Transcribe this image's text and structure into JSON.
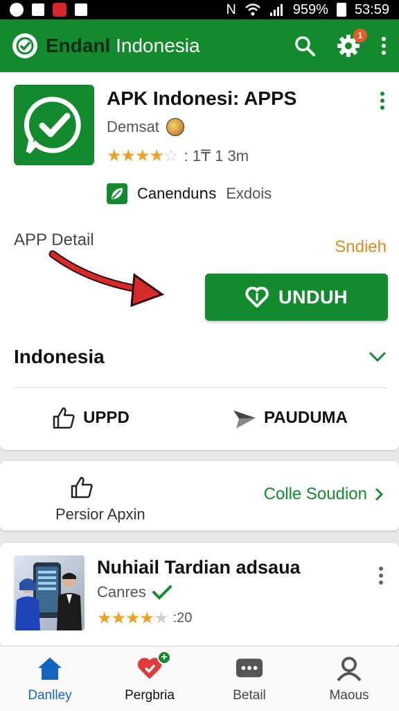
{
  "status_bar": {
    "battery": "959%",
    "time": "53:59",
    "signal_text": "N"
  },
  "app_bar": {
    "title_bold": "Endanl",
    "title_rest": "Indonesia",
    "notification_badge": "1"
  },
  "app": {
    "name": "APK Indonesi: APPS",
    "developer": "Demsat",
    "rating_text": ": 1₸ 1 3m",
    "category_strong": "Canenduոs",
    "category_light": "Exdois"
  },
  "detail": {
    "label": "APP Detail",
    "side_link": "Sndieh",
    "download_button": "UNDUH",
    "language": "Indonesia",
    "action_left": "UPPD",
    "action_right": "PAUDUMA"
  },
  "second_card": {
    "label": "Persior Apxin",
    "link": "Colle Soudion"
  },
  "promo": {
    "title": "Nuhiail Tardian adsaua",
    "subtitle": "Canres",
    "rating_text": ":20"
  },
  "bottom_nav": [
    {
      "label": "Danlley",
      "icon": "home-icon",
      "active": true
    },
    {
      "label": "Pergbria",
      "icon": "heart-icon",
      "active": false
    },
    {
      "label": "Betail",
      "icon": "chat-icon",
      "active": false
    },
    {
      "label": "Maous",
      "icon": "profile-icon",
      "active": false
    }
  ],
  "colors": {
    "primary_green": "#138a2e",
    "accent_orange": "#e08a1e",
    "active_blue": "#1565c0",
    "star": "#f0a020"
  }
}
